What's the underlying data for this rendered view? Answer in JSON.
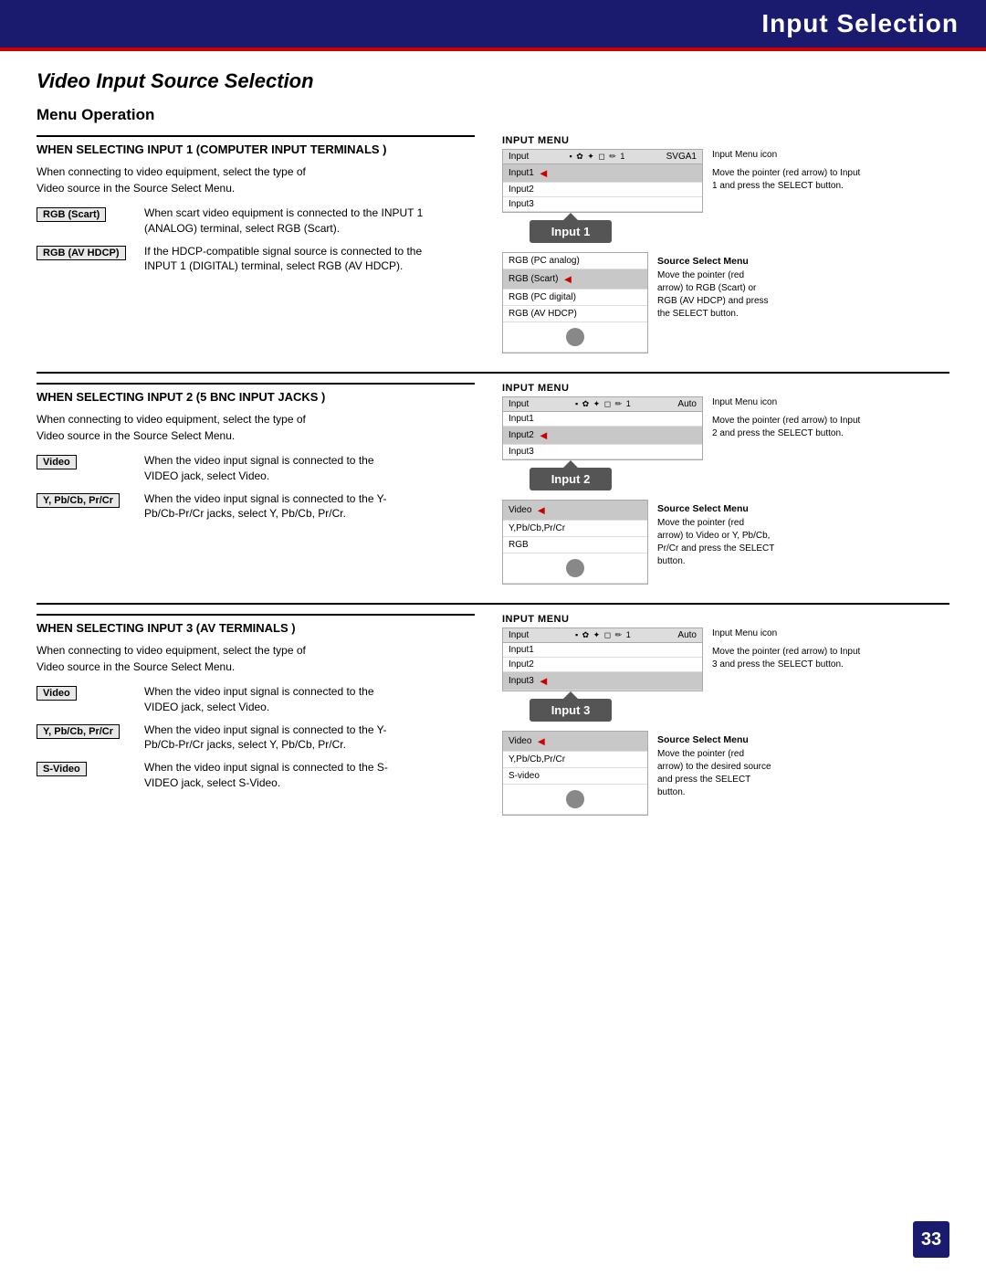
{
  "header": {
    "title": "Input Selection",
    "page_number": "33"
  },
  "page_title": "Video Input Source Selection",
  "section_menu_operation": "Menu Operation",
  "sections": [
    {
      "id": "input1",
      "title": "WHEN SELECTING INPUT 1 (COMPUTER INPUT TERMINALS )",
      "body": "When connecting to video equipment, select the type of\nVideo source in the Source Select Menu.",
      "tags": [
        {
          "label": "RGB (Scart)",
          "desc": "When scart video equipment is connected to the INPUT 1\n(ANALOG) terminal, select RGB (Scart)."
        },
        {
          "label": "RGB (AV HDCP)",
          "desc": "If the HDCP-compatible signal source is connected to the\nINPUT 1 (DIGITAL) terminal, select RGB (AV HDCP)."
        }
      ],
      "input_menu": {
        "label": "INPUT MENU",
        "header_left": "Input",
        "header_right": "SVGA1",
        "rows": [
          "Input1",
          "Input2",
          "Input3"
        ],
        "selected_row": 0,
        "arrow_label": "Input 1",
        "note_icon": "Input Menu icon",
        "note_arrow": "Move the pointer (red arrow) to Input\n1 and press the SELECT button."
      },
      "source_select": {
        "label": "Source Select Menu",
        "rows": [
          "RGB (PC analog)",
          "RGB (Scart)",
          "RGB (PC digital)",
          "RGB (AV HDCP)"
        ],
        "selected_row": 1,
        "note": "Move the pointer (red\narrow) to RGB (Scart) or\nRGB (AV HDCP) and press\nthe SELECT button."
      }
    },
    {
      "id": "input2",
      "title": "WHEN SELECTING INPUT 2 (5 BNC INPUT JACKS )",
      "body": "When connecting to video equipment, select the type of\nVideo source in the Source Select Menu.",
      "tags": [
        {
          "label": "Video",
          "desc": "When the video input signal is connected to the\nVIDEO jack, select Video."
        },
        {
          "label": "Y, Pb/Cb, Pr/Cr",
          "desc": "When the video input signal is connected to the Y-\nPb/Cb-Pr/Cr jacks, select Y, Pb/Cb, Pr/Cr."
        }
      ],
      "input_menu": {
        "label": "INPUT MENU",
        "header_left": "Input",
        "header_right": "Auto",
        "rows": [
          "Input1",
          "Input2",
          "Input3"
        ],
        "selected_row": 1,
        "arrow_label": "Input 2",
        "note_icon": "Input Menu icon",
        "note_arrow": "Move the pointer (red arrow) to Input\n2 and press the SELECT button."
      },
      "source_select": {
        "label": "Source Select Menu",
        "rows": [
          "Video",
          "Y,Pb/Cb,Pr/Cr",
          "RGB"
        ],
        "selected_row": 0,
        "note": "Move the pointer (red\narrow) to Video or Y, Pb/Cb,\nPr/Cr and press the SELECT\nbutton."
      }
    },
    {
      "id": "input3",
      "title": "WHEN SELECTING INPUT 3 (AV TERMINALS )",
      "body": "When connecting to video equipment, select the type of\nVideo source in the Source Select Menu.",
      "tags": [
        {
          "label": "Video",
          "desc": "When the video input signal is connected to the\nVIDEO jack, select Video."
        },
        {
          "label": "Y, Pb/Cb, Pr/Cr",
          "desc": "When the video input signal is connected to the Y-\nPb/Cb-Pr/Cr jacks, select Y, Pb/Cb, Pr/Cr."
        },
        {
          "label": "S-Video",
          "desc": "When the video input signal is connected to the S-\nVIDEO jack, select S-Video."
        }
      ],
      "input_menu": {
        "label": "INPUT MENU",
        "header_left": "Input",
        "header_right": "Auto",
        "rows": [
          "Input1",
          "Input2",
          "Input3"
        ],
        "selected_row": 2,
        "arrow_label": "Input 3",
        "note_icon": "Input Menu icon",
        "note_arrow": "Move the pointer (red arrow) to Input\n3 and press the SELECT button."
      },
      "source_select": {
        "label": "Source Select Menu",
        "rows": [
          "Video",
          "Y,Pb/Cb,Pr/Cr",
          "S-video"
        ],
        "selected_row": 0,
        "note": "Move the pointer (red\narrow) to the desired source\nand press the SELECT\nbutton."
      }
    }
  ]
}
